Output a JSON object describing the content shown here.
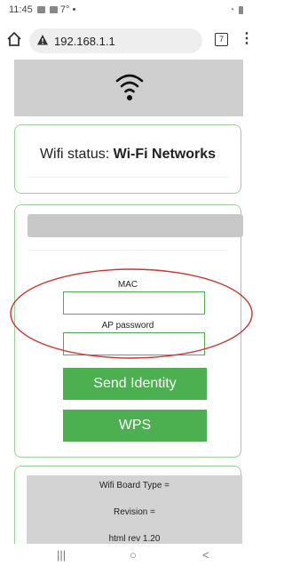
{
  "statusbar": {
    "time": "11:45",
    "temp": "7°"
  },
  "browser": {
    "url": "192.168.1.1",
    "tab_count": "7"
  },
  "wifi_status": {
    "label": "Wifi status: ",
    "value": "Wi-Fi Networks"
  },
  "form": {
    "mac_label": "MAC",
    "mac_value": "",
    "ap_password_label": "AP password",
    "ap_password_value": "",
    "send_identity_label": "Send Identity",
    "wps_label": "WPS"
  },
  "info": {
    "board_type": "Wifi Board Type =",
    "revision": "Revision =",
    "html_rev": "html rev 1.20"
  },
  "colors": {
    "accent": "#4caf50",
    "annotation": "#d0342c",
    "header_gray": "#cfcfcf"
  },
  "icons": [
    "home-icon",
    "warning-icon",
    "tabs-icon",
    "menu-icon",
    "wifi-icon",
    "recents-icon",
    "home-nav-icon",
    "back-icon"
  ]
}
